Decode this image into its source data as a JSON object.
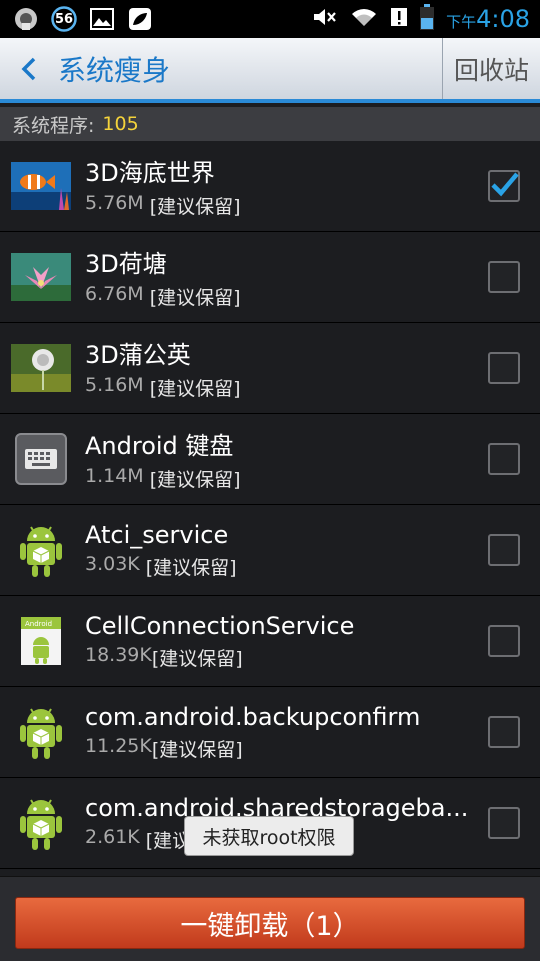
{
  "status_bar": {
    "notification_badge": "56",
    "time_prefix": "下午",
    "time": "4:08"
  },
  "header": {
    "title": "系统瘦身",
    "recycle_label": "回收站"
  },
  "summary": {
    "label": "系统程序:",
    "count": "105"
  },
  "apps": [
    {
      "name": "3D海底世界",
      "size": "5.76M",
      "tag": "[建议保留]",
      "checked": true,
      "icon": "fish-wallpaper-icon"
    },
    {
      "name": "3D荷塘",
      "size": "6.76M",
      "tag": "[建议保留]",
      "checked": false,
      "icon": "lotus-wallpaper-icon"
    },
    {
      "name": "3D蒲公英",
      "size": "5.16M",
      "tag": "[建议保留]",
      "checked": false,
      "icon": "dandelion-wallpaper-icon"
    },
    {
      "name": "Android 键盘",
      "size": "1.14M",
      "tag": "[建议保留]",
      "checked": false,
      "icon": "keyboard-icon"
    },
    {
      "name": "Atci_service",
      "size": "3.03K",
      "tag": "[建议保留]",
      "checked": false,
      "icon": "android-robot-icon"
    },
    {
      "name": "CellConnectionService",
      "size": "18.39K",
      "tag": "[建议保留]",
      "checked": false,
      "icon": "android-package-icon"
    },
    {
      "name": "com.android.backupconfirm",
      "size": "11.25K",
      "tag": "[建议保留]",
      "checked": false,
      "icon": "android-robot-icon"
    },
    {
      "name": "com.android.sharedstorageba...",
      "size": "2.61K",
      "tag": "[建议保留]",
      "checked": false,
      "icon": "android-robot-icon"
    }
  ],
  "toast": "未获取root权限",
  "footer": {
    "uninstall_label": "一键卸载（1）"
  },
  "colors": {
    "accent": "#2a8ad6",
    "count_highlight": "#f4d33b",
    "uninstall": "#d24a26"
  }
}
